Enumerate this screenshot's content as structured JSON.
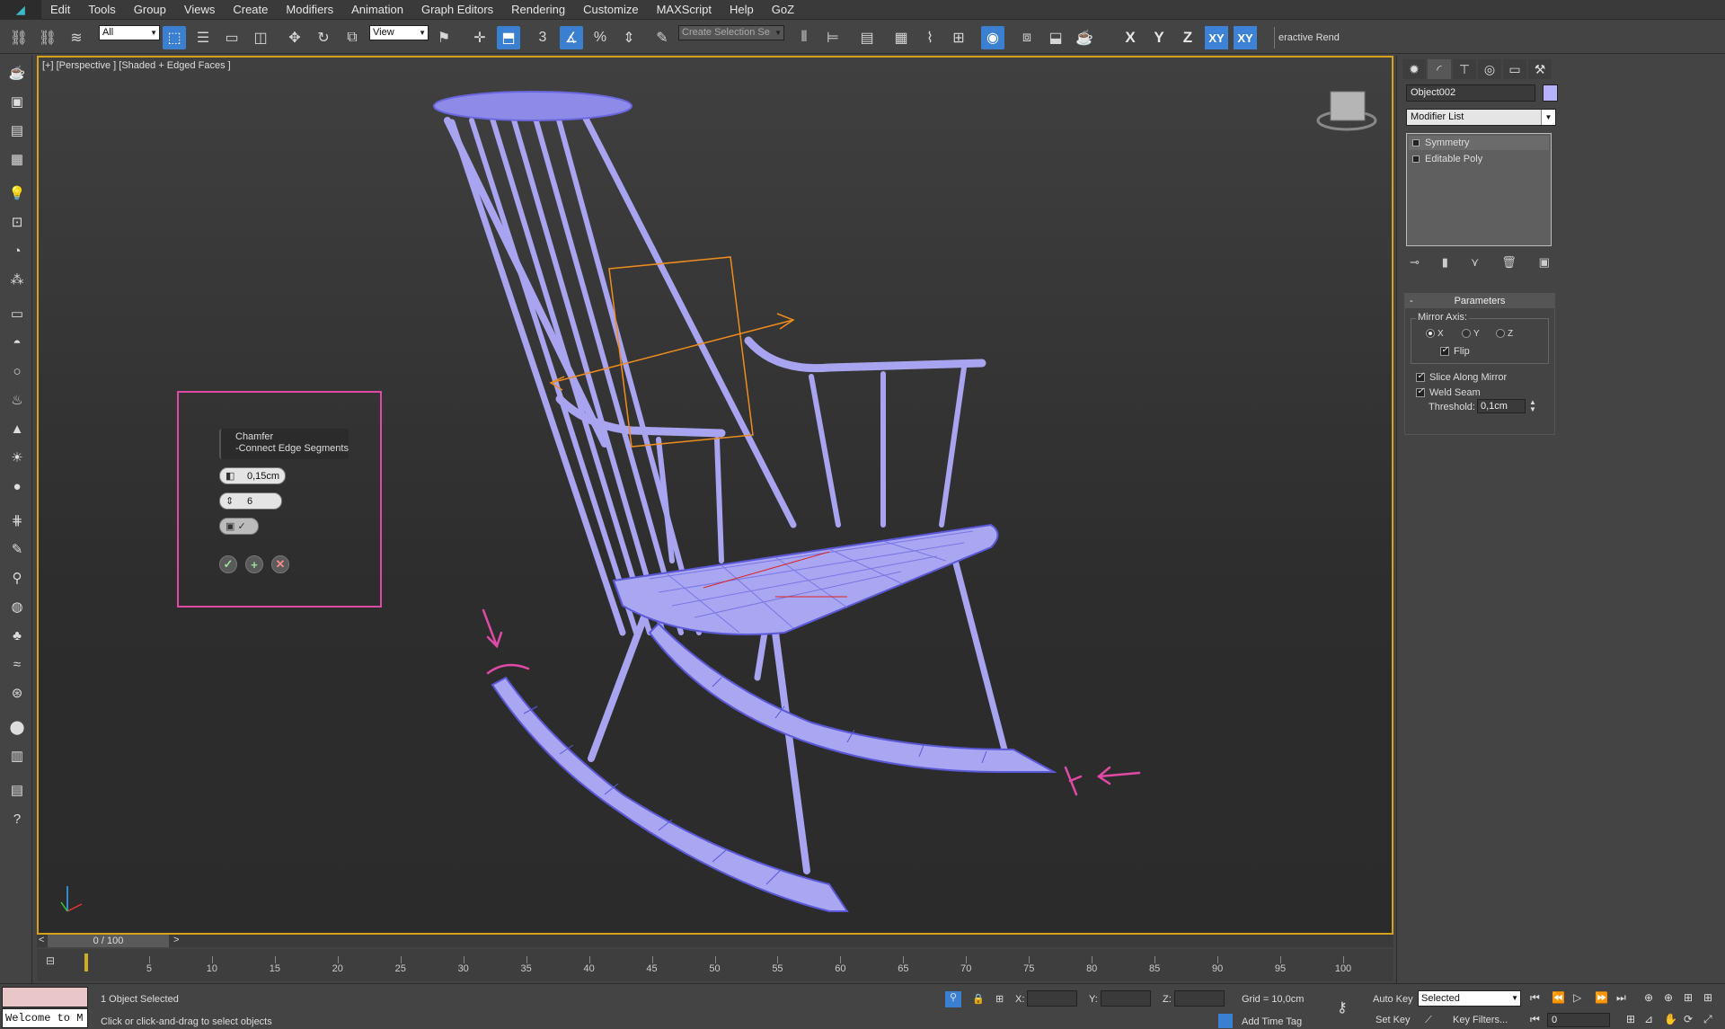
{
  "menu": [
    "Edit",
    "Tools",
    "Group",
    "Views",
    "Create",
    "Modifiers",
    "Animation",
    "Graph Editors",
    "Rendering",
    "Customize",
    "MAXScript",
    "Help",
    "GoZ"
  ],
  "toolbar": {
    "filter_select": "All",
    "ref_coord_select": "View",
    "selection_set_placeholder": "Create Selection Se",
    "axes": [
      "X",
      "Y",
      "Z",
      "XY",
      "XY"
    ],
    "interactive_tab": "eractive Rend"
  },
  "viewport": {
    "label": "[+] [Perspective ] [Shaded + Edged Faces ]"
  },
  "caddy": {
    "title_line1": "Chamfer",
    "title_line2": "-Connect Edge Segments",
    "amount": "0,15cm",
    "segments": "6"
  },
  "command_panel": {
    "object_name": "Object002",
    "object_color": "#b7b2ff",
    "modifier_list": "Modifier List",
    "stack": [
      "Symmetry",
      "Editable Poly"
    ],
    "rollout_title": "Parameters",
    "mirror_axis_label": "Mirror Axis:",
    "axis_options": [
      "X",
      "Y",
      "Z"
    ],
    "axis_selected": "X",
    "flip_label": "Flip",
    "slice_label": "Slice Along Mirror",
    "weld_label": "Weld Seam",
    "threshold_label": "Threshold:",
    "threshold_value": "0,1cm"
  },
  "timeslider": {
    "position": "0 / 100"
  },
  "trackbar": {
    "ticks": [
      "5",
      "10",
      "15",
      "20",
      "25",
      "30",
      "35",
      "40",
      "45",
      "50",
      "55",
      "60",
      "65",
      "70",
      "75",
      "80",
      "85",
      "90",
      "95",
      "100"
    ]
  },
  "status": {
    "maxscript_text": "Welcome to M",
    "selection_info": "1 Object Selected",
    "prompt": "Click or click-and-drag to select objects",
    "x_label": "X:",
    "y_label": "Y:",
    "z_label": "Z:",
    "grid": "Grid = 10,0cm",
    "add_time_tag": "Add Time Tag",
    "auto_key": "Auto Key",
    "set_key": "Set Key",
    "key_mode": "Selected",
    "key_filters": "Key Filters...",
    "frame": "0"
  },
  "colors": {
    "viewport_border": "#d6a21b",
    "selection_highlight": "#e04aa6",
    "mesh": "#a9a6f2",
    "active_button": "#3b7fd0"
  }
}
